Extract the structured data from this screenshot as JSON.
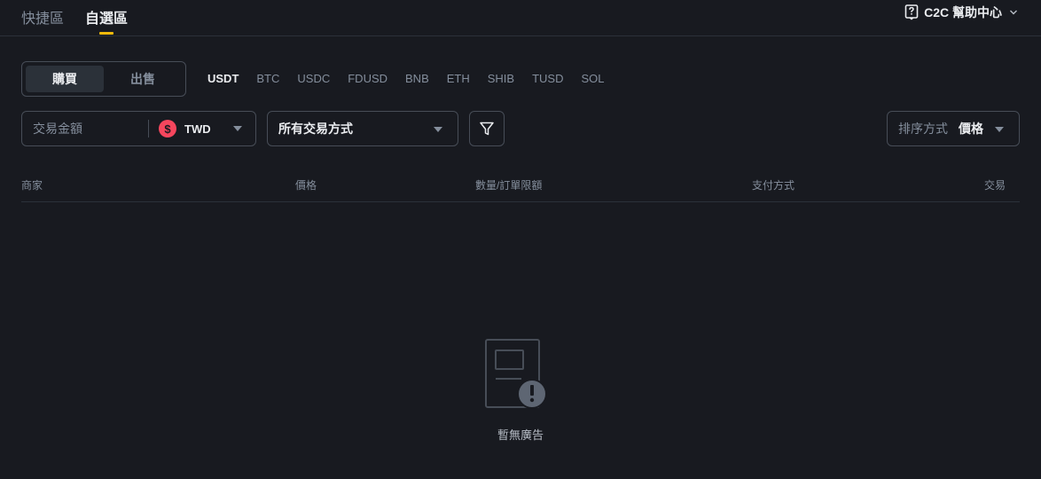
{
  "top_tabs": [
    {
      "label": "快捷區",
      "active": false
    },
    {
      "label": "自選區",
      "active": true
    }
  ],
  "help": {
    "label": "C2C 幫助中心"
  },
  "trade_toggle": {
    "buy": "購買",
    "sell": "出售",
    "active": "buy"
  },
  "assets": [
    "USDT",
    "BTC",
    "USDC",
    "FDUSD",
    "BNB",
    "ETH",
    "SHIB",
    "TUSD",
    "SOL"
  ],
  "active_asset": "USDT",
  "amount": {
    "placeholder": "交易金額",
    "value": ""
  },
  "currency": {
    "symbol": "$",
    "code": "TWD"
  },
  "payment_method": {
    "selected": "所有交易方式"
  },
  "sort": {
    "label": "排序方式",
    "value": "價格"
  },
  "table": {
    "headers": [
      "商家",
      "價格",
      "數量/訂單限額",
      "支付方式",
      "交易"
    ]
  },
  "empty": {
    "message": "暫無廣告"
  },
  "colors": {
    "background": "#181a20",
    "accent": "#f0b90b",
    "border": "#474d57",
    "muted": "#848e9c",
    "currency_icon": "#f6465d"
  }
}
